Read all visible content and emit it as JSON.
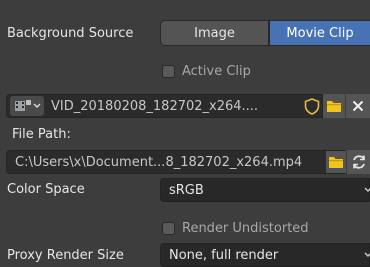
{
  "background_source": {
    "label": "Background Source",
    "options": [
      "Image",
      "Movie Clip"
    ],
    "selected": "Movie Clip"
  },
  "active_clip": {
    "label": "Active Clip",
    "checked": false
  },
  "clip_selector": {
    "value": "VID_20180208_182702_x264...."
  },
  "file_path": {
    "label": "File Path:",
    "value": "C:\\Users\\x\\Document...8_182702_x264.mp4"
  },
  "color_space": {
    "label": "Color Space",
    "value": "sRGB"
  },
  "render_undistorted": {
    "label": "Render Undistorted",
    "checked": false
  },
  "proxy_render_size": {
    "label": "Proxy Render Size",
    "value": "None, full render"
  },
  "colors": {
    "accent": "#4772b3",
    "folder": "#f0c419",
    "shield": "#e8b54a"
  }
}
